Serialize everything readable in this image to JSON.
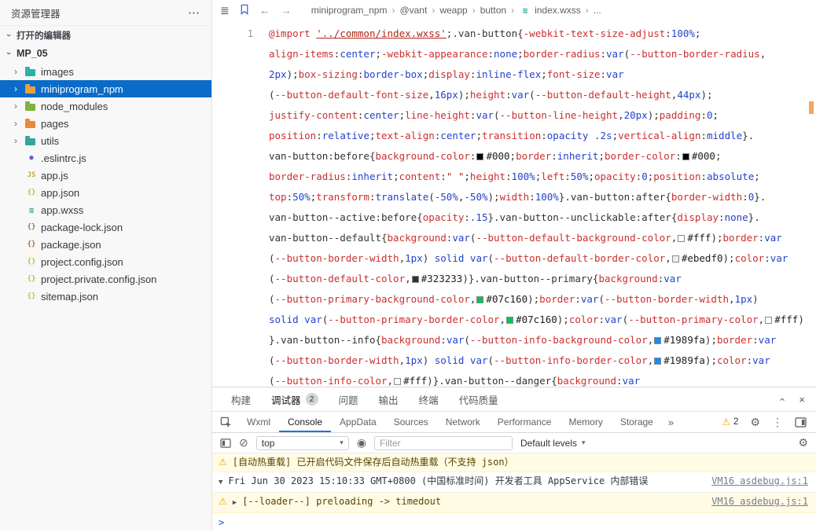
{
  "colors": {
    "selection": "#0a6cc8",
    "tab_accent": "#1a73e8",
    "warning_bg": "#fffbe5"
  },
  "icons": {
    "menu": "⋯",
    "list": "≣",
    "back": "←",
    "forward": "→",
    "crumb_sep": "›",
    "chevron": "›",
    "warning": "⚠",
    "triangle_down": "▼",
    "triangle_right": "▶",
    "clear": "⊘",
    "eye": "◉",
    "caret": "▾",
    "gear": "⚙",
    "kebab": "⋮",
    "overflow": "»",
    "close": "×",
    "prompt": ">"
  },
  "sidebar": {
    "header": {
      "title": "资源管理器"
    },
    "open_editors": "打开的编辑器",
    "project": "MP_05",
    "tree": [
      {
        "label": "images",
        "kind": "folder",
        "color": "#2bb3a8"
      },
      {
        "label": "miniprogram_npm",
        "kind": "folder",
        "color": "#e9a23b",
        "selected": true
      },
      {
        "label": "node_modules",
        "kind": "folder",
        "color": "#7cb342"
      },
      {
        "label": "pages",
        "kind": "folder",
        "color": "#e98a3b"
      },
      {
        "label": "utils",
        "kind": "folder",
        "color": "#35a5a0"
      },
      {
        "label": ".eslintrc.js",
        "kind": "file",
        "glyph": "●",
        "color": "#6b5bc9",
        "icon": "eslint-file-icon"
      },
      {
        "label": "app.js",
        "kind": "file",
        "glyph": "JS",
        "color": "#c9a93a",
        "icon": "js-file-icon"
      },
      {
        "label": "app.json",
        "kind": "file",
        "glyph": "{}",
        "color": "#c9ba35",
        "icon": "json-file-icon"
      },
      {
        "label": "app.wxss",
        "kind": "file",
        "glyph": "≋",
        "big": true,
        "color": "#2aa198",
        "icon": "wxss-file-icon"
      },
      {
        "label": "package-lock.json",
        "kind": "file",
        "glyph": "{}",
        "color": "#ad6a34",
        "icon": "json-file-icon"
      },
      {
        "label": "package.json",
        "kind": "file",
        "glyph": "{}",
        "color": "#ad6a34",
        "icon": "json-file-icon"
      },
      {
        "label": "project.config.json",
        "kind": "file",
        "glyph": "{}",
        "color": "#c9ba35",
        "icon": "json-file-icon"
      },
      {
        "label": "project.private.config.json",
        "kind": "file",
        "glyph": "{}",
        "color": "#c9ba35",
        "icon": "json-file-icon"
      },
      {
        "label": "sitemap.json",
        "kind": "file",
        "glyph": "{}",
        "color": "#c9ba35",
        "icon": "json-file-icon"
      }
    ]
  },
  "editor": {
    "breadcrumb": [
      {
        "label": "miniprogram_npm"
      },
      {
        "label": "@vant"
      },
      {
        "label": "weapp"
      },
      {
        "label": "button"
      },
      {
        "label": "index.wxss",
        "glyph": "≋",
        "glyph_color": "#2aa198",
        "icon": "wxss-file-icon"
      },
      {
        "label": "..."
      }
    ],
    "line_number": "1",
    "code_lines": [
      "@import '../common/index.wxss';.van-button{-webkit-text-size-adjust:100%;",
      "align-items:center;-webkit-appearance:none;border-radius:var(--button-border-radius,",
      "2px);box-sizing:border-box;display:inline-flex;font-size:var",
      "(--button-default-font-size,16px);height:var(--button-default-height,44px);",
      "justify-content:center;line-height:var(--button-line-height,20px);padding:0;",
      "position:relative;text-align:center;transition:opacity .2s;vertical-align:middle}.",
      "van-button:before{background-color:#000;border:inherit;border-color:#000;",
      "border-radius:inherit;content:\" \";height:100%;left:50%;opacity:0;position:absolute;",
      "top:50%;transform:translate(-50%,-50%);width:100%}.van-button:after{border-width:0}.",
      "van-button--active:before{opacity:.15}.van-button--unclickable:after{display:none}.",
      "van-button--default{background:var(--button-default-background-color,#fff);border:var",
      "(--button-border-width,1px) solid var(--button-default-border-color,#ebedf0);color:var",
      "(--button-default-color,#323233)}.van-button--primary{background:var",
      "(--button-primary-background-color,#07c160);border:var(--button-border-width,1px)",
      "solid var(--button-primary-border-color,#07c160);color:var(--button-primary-color,#fff)",
      "}.van-button--info{background:var(--button-info-background-color,#1989fa);border:var",
      "(--button-border-width,1px) solid var(--button-info-border-color,#1989fa);color:var",
      "(--button-info-color,#fff)}.van-button--danger{background:var"
    ]
  },
  "panel": {
    "tabs": [
      {
        "label": "构建"
      },
      {
        "label": "调试器",
        "badge": "2",
        "active": true
      },
      {
        "label": "问题"
      },
      {
        "label": "输出"
      },
      {
        "label": "终端"
      },
      {
        "label": "代码质量"
      }
    ]
  },
  "devtools": {
    "tabs": [
      "Wxml",
      "Console",
      "AppData",
      "Sources",
      "Network",
      "Performance",
      "Memory",
      "Storage"
    ],
    "active_tab": "Console",
    "warning_count": "2",
    "toolbar": {
      "context": "top",
      "filter_placeholder": "Filter",
      "levels": "Default levels"
    },
    "console": {
      "messages": [
        {
          "type": "warning",
          "text": "[自动热重载] 已开启代码文件保存后自动热重载（不支持 json）"
        },
        {
          "type": "log",
          "expand": "▼",
          "text": "Fri Jun 30 2023 15:10:33 GMT+0800 (中国标准时间) 开发者工具 AppService 内部错误",
          "source": "VM16 asdebug.js:1"
        },
        {
          "type": "warning",
          "expand": "▶",
          "text": "[--loader--] preloading -> timedout",
          "source": "VM16 asdebug.js:1"
        }
      ]
    }
  }
}
